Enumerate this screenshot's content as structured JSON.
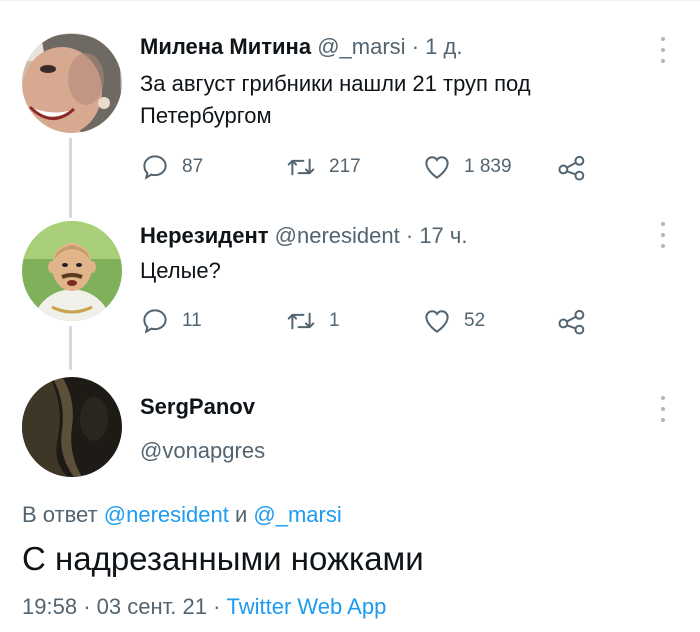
{
  "tweets": [
    {
      "name": "Милена Митина",
      "handle": "@_marsi",
      "sep": "·",
      "time": "1 д.",
      "text_line1": "За август грибники нашли 21 труп под",
      "text_line2": "Петербургом",
      "replies": "87",
      "retweets": "217",
      "likes": "1 839"
    },
    {
      "name": "Нерезидент",
      "handle": "@neresident",
      "sep": "·",
      "time": "17 ч.",
      "text_line1": "Целые?",
      "replies": "11",
      "retweets": "1",
      "likes": "52"
    }
  ],
  "main_tweet": {
    "name": "SergPanov",
    "handle": "@vonapgres",
    "reply_prefix": "В ответ",
    "reply_user1": "@neresident",
    "reply_and": "и",
    "reply_user2": "@_marsi",
    "text": "С надрезанными ножками",
    "time": "19:58",
    "date": "03 сент. 21",
    "source": "Twitter Web App",
    "sep": "·"
  },
  "icons": [
    "reply-icon",
    "retweet-icon",
    "like-icon",
    "share-icon",
    "more-icon"
  ],
  "colors": {
    "link": "#1d9bf0",
    "meta": "#536471",
    "text": "#0f1419",
    "thread_line": "#cfd9de"
  }
}
